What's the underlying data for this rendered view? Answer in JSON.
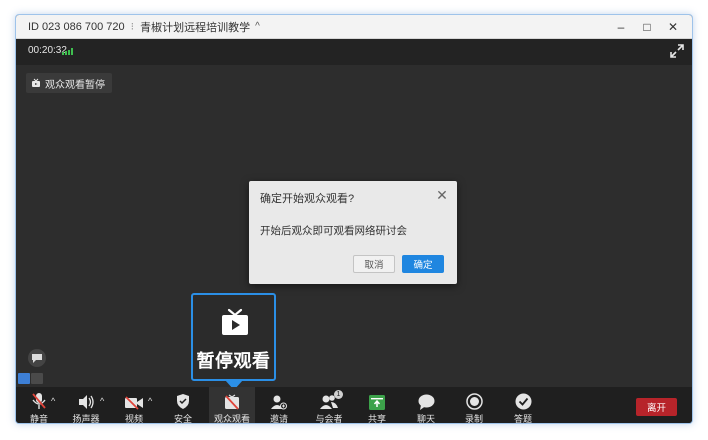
{
  "title_bar": {
    "meeting_id": "ID 023 086 700 720",
    "separator": "⁝",
    "meeting_name": "青椒计划远程培训教学",
    "chevron": "^",
    "controls": {
      "minimize": "–",
      "maximize": "□",
      "close": "✕"
    }
  },
  "status_bar": {
    "elapsed_time": "00:20:32"
  },
  "stage": {
    "paused_tag": "观众观看暂停",
    "tooltip_text": "暂停观看"
  },
  "dialog": {
    "title": "确定开始观众观看?",
    "close": "✕",
    "message": "开始后观众即可观看网络研讨会",
    "cancel_label": "取消",
    "confirm_label": "确定"
  },
  "toolbar": {
    "mute": "静音",
    "speaker": "扬声器",
    "video": "视频",
    "security": "安全",
    "audience_view": "观众观看",
    "invite": "邀请",
    "participants": "与会者",
    "participants_count": "1",
    "share": "共享",
    "chat": "聊天",
    "record": "录制",
    "qa": "答题",
    "leave": "离开",
    "caret": "^"
  },
  "colors": {
    "accent": "#2b8fe6",
    "confirm": "#1f86e0",
    "leave": "#b7242a",
    "signal": "#3fbf4f",
    "share": "#3ca24a"
  }
}
